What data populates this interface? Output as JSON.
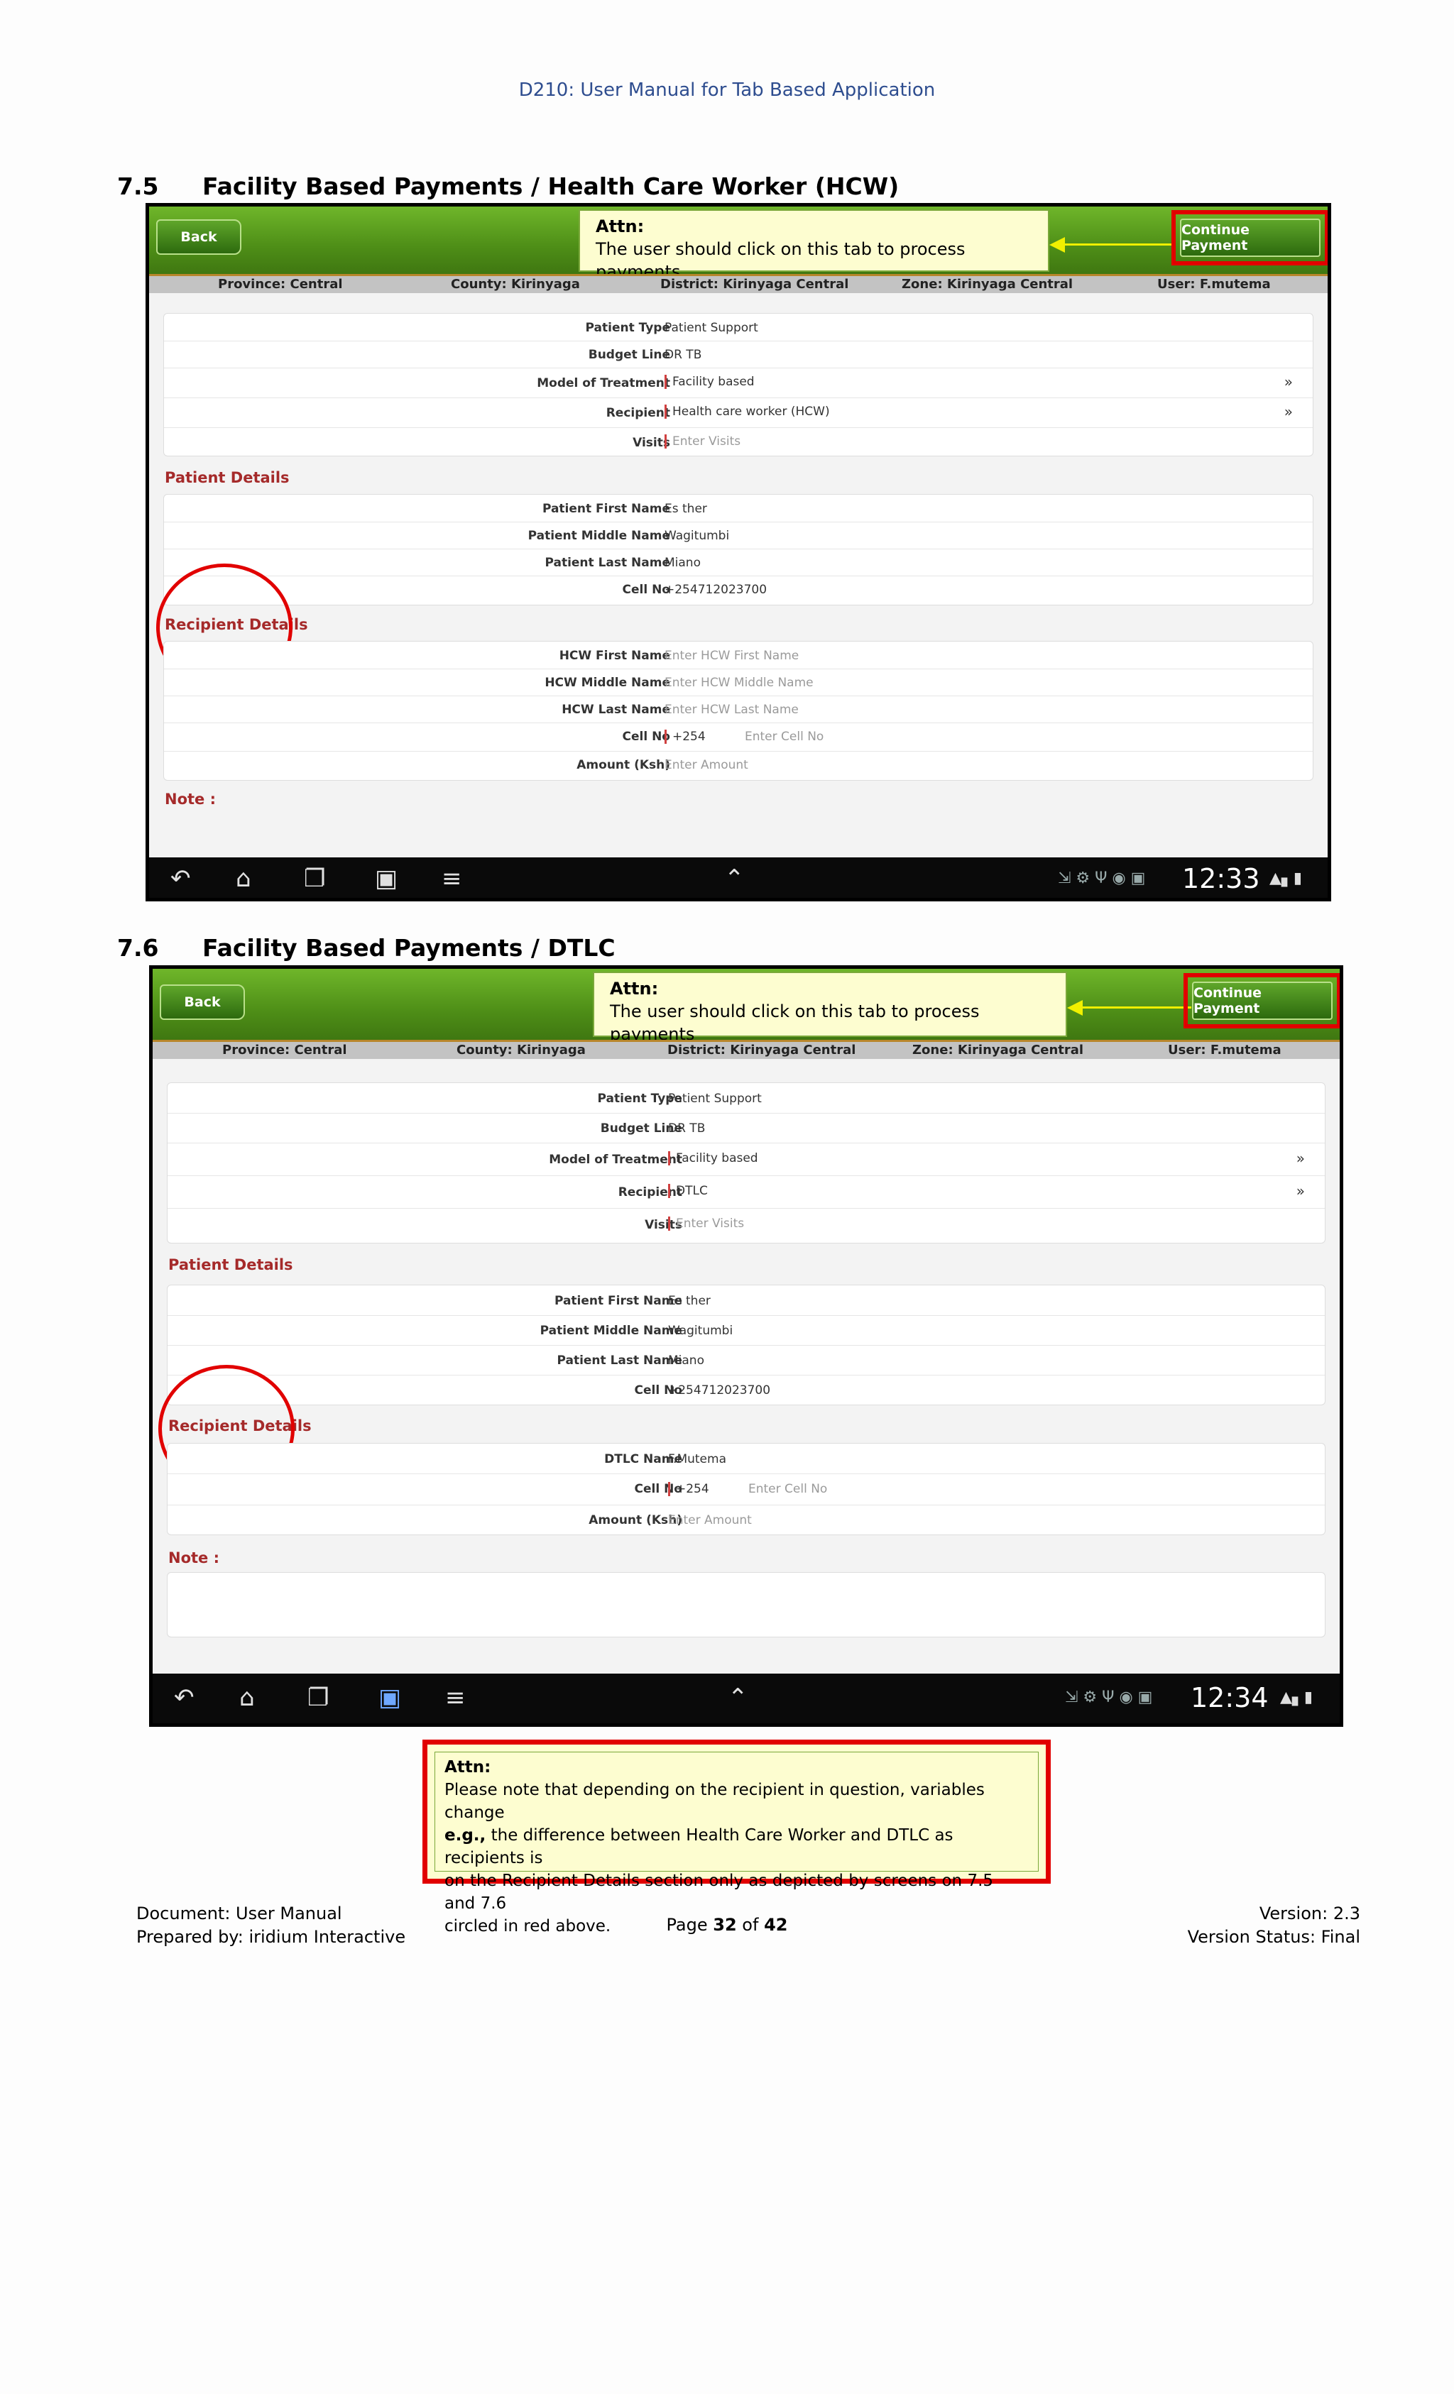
{
  "doc": {
    "title": "D210: User Manual for Tab Based Application"
  },
  "sections": [
    {
      "number": "7.5",
      "heading": "Facility Based Payments /  Health Care Worker (HCW)",
      "screen": {
        "back_label": "Back",
        "attn_title": "Attn:",
        "attn_text": "The user should click on this tab to process payments",
        "continue_label": "Continue Payment",
        "infobar": {
          "province": "Province: Central",
          "county": "County: Kirinyaga",
          "district": "District: Kirinyaga Central",
          "zone": "Zone: Kirinyaga Central",
          "user": "User: F.mutema"
        },
        "top_rows": [
          {
            "label": "Patient Type",
            "value": "Patient Support"
          },
          {
            "label": "Budget Line",
            "value": "DR TB"
          },
          {
            "label": "Model of Treatment",
            "value": "Facility based"
          },
          {
            "label": "Recipient",
            "value": "Health care worker (HCW)"
          },
          {
            "label": "Visits",
            "value": "Enter Visits"
          }
        ],
        "patient_details_label": "Patient Details",
        "patient_rows": [
          {
            "label": "Patient First Name",
            "value": "Es ther"
          },
          {
            "label": "Patient Middle Name",
            "value": "Wagitumbi"
          },
          {
            "label": "Patient Last Name",
            "value": "Miano"
          },
          {
            "label": "Cell No",
            "value": "+254712023700"
          }
        ],
        "recipient_details_label": "Recipient Details",
        "recipient_rows": [
          {
            "label": "HCW First Name",
            "value": "Enter HCW First Name"
          },
          {
            "label": "HCW Middle Name",
            "value": "Enter HCW Middle Name"
          },
          {
            "label": "HCW Last Name",
            "value": "Enter HCW Last Name"
          },
          {
            "label": "Cell No",
            "value": "+254",
            "value2": "Enter Cell No"
          },
          {
            "label": "Amount (Ksh)",
            "value": "Enter Amount"
          }
        ],
        "note_label": "Note :",
        "clock": "12:33"
      }
    },
    {
      "number": "7.6",
      "heading": "Facility Based Payments / DTLC",
      "screen": {
        "back_label": "Back",
        "attn_title": "Attn:",
        "attn_text": "The user should click on this tab to process payments",
        "continue_label": "Continue Payment",
        "infobar": {
          "province": "Province: Central",
          "county": "County: Kirinyaga",
          "district": "District: Kirinyaga Central",
          "zone": "Zone: Kirinyaga Central",
          "user": "User: F.mutema"
        },
        "top_rows": [
          {
            "label": "Patient Type",
            "value": "Patient Support"
          },
          {
            "label": "Budget Line",
            "value": "DR TB"
          },
          {
            "label": "Model of Treatment",
            "value": "Facility based"
          },
          {
            "label": "Recipient",
            "value": "DTLC"
          },
          {
            "label": "Visits",
            "value": "Enter Visits"
          }
        ],
        "patient_details_label": "Patient Details",
        "patient_rows": [
          {
            "label": "Patient First Name",
            "value": "Es ther"
          },
          {
            "label": "Patient Middle Name",
            "value": "Wagitumbi"
          },
          {
            "label": "Patient Last Name",
            "value": "Miano"
          },
          {
            "label": "Cell No",
            "value": "+254712023700"
          }
        ],
        "recipient_details_label": "Recipient Details",
        "recipient_rows": [
          {
            "label": "DTLC Name",
            "value": "F.Mutema"
          },
          {
            "label": "Cell No",
            "value": "+254",
            "value2": "Enter Cell No"
          },
          {
            "label": "Amount (Ksh)",
            "value": "Enter Amount"
          }
        ],
        "note_label": "Note :",
        "clock": "12:34"
      }
    }
  ],
  "bottom_attn": {
    "title": "Attn:",
    "line1": "Please note that depending on the recipient in question, variables change",
    "eg": "e.g.,",
    "line2_rest": " the difference between Health Care Worker and DTLC as recipients is",
    "line3": "on the Recipient Details section only  as depicted by screens on 7.5 and 7.6",
    "line4": "circled in red above."
  },
  "footer": {
    "document": "Document: User Manual",
    "prepared": "Prepared by: iridium Interactive",
    "page_prefix": "Page ",
    "page_num": "32",
    "page_of": " of ",
    "page_total": "42",
    "version": "Version: 2.3",
    "status": "Version Status: Final"
  },
  "icons": {
    "nav": [
      "back-icon",
      "home-icon",
      "recent-apps-icon",
      "screenshot-icon",
      "menu-icon",
      "chevron-up-icon"
    ],
    "status": [
      "expand-icon",
      "usb-icon",
      "notification-icon",
      "gallery-icon",
      "wifi-icon",
      "signal-icon",
      "battery-icon"
    ]
  }
}
